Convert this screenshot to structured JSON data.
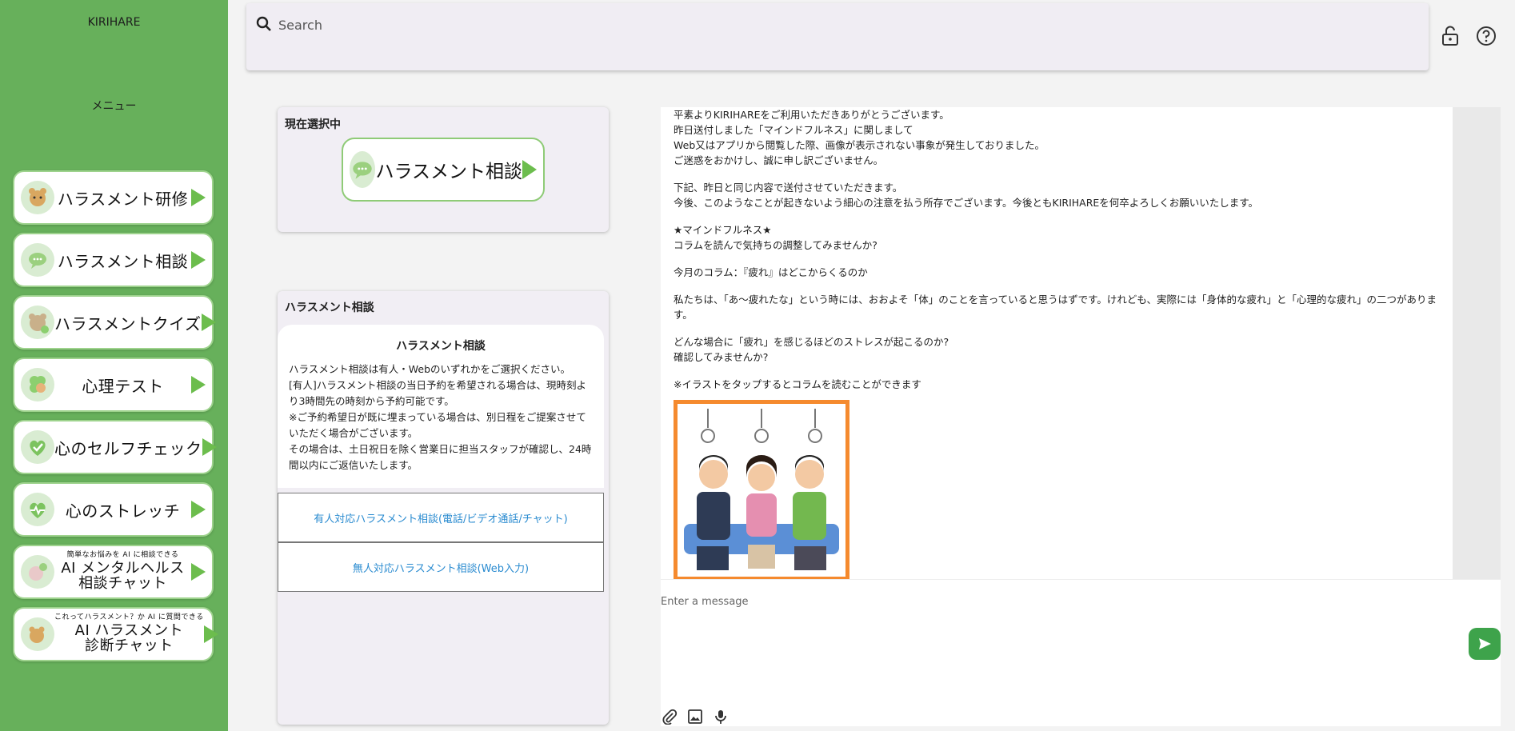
{
  "sidebar": {
    "brand": "KIRIHARE",
    "menu_title": "メニュー",
    "items": [
      {
        "label": "ハラスメント研修"
      },
      {
        "label": "ハラスメント相談"
      },
      {
        "label": "ハラスメントクイズ"
      },
      {
        "label": "心理テスト"
      },
      {
        "label": "心のセルフチェック"
      },
      {
        "label": "心のストレッチ"
      },
      {
        "sub": "簡単なお悩みを AI に相談できる",
        "line1": "AI メンタルヘルス",
        "line2": "相談チャット"
      },
      {
        "sub": "これってハラスメント？か AI に質問できる",
        "line1": "AI ハラスメント",
        "line2": "診断チャット"
      }
    ]
  },
  "search": {
    "placeholder": "Search"
  },
  "topbar": {
    "lock_icon": "lock-open-icon",
    "help_icon": "help-icon"
  },
  "selected": {
    "title": "現在選択中",
    "button_label": "ハラスメント相談"
  },
  "consult": {
    "panel_title": "ハラスメント相談",
    "card_title": "ハラスメント相談",
    "body": [
      "ハラスメント相談は有人・Webのいずれかをご選択ください。",
      "[有人]ハラスメント相談の当日予約を希望される場合は、現時刻より3時間先の時刻から予約可能です。",
      "※ご予約希望日が既に埋まっている場合は、別日程をご提案させていただく場合がございます。",
      "その場合は、土日祝日を除く営業日に担当スタッフが確認し、24時間以内にご返信いたします。"
    ],
    "option1": "有人対応ハラスメント相談(電話/ビデオ通話/チャット)",
    "option2": "無人対応ハラスメント相談(Web入力)"
  },
  "chat": {
    "paragraphs": [
      [
        "平素よりKIRIHAREをご利用いただきありがとうございます。",
        "昨日送付しました「マインドフルネス」に関しまして",
        "Web又はアプリから閲覧した際、画像が表示されない事象が発生しておりました。",
        "ご迷惑をおかけし、誠に申し訳ございません。"
      ],
      [
        "下記、昨日と同じ内容で送付させていただきます。",
        "今後、このようなことが起きないよう細心の注意を払う所存でございます。今後ともKIRIHAREを何卒よろしくお願いいたします。"
      ],
      [
        "★マインドフルネス★",
        "コラムを読んで気持ちの調整してみませんか?"
      ],
      [
        "今月のコラム：『疲れ』はどこからくるのか"
      ],
      [
        "私たちは、「あ〜疲れたな」という時には、おおよそ「体」のことを言っていると思うはずです。けれども、実際には「身体的な疲れ」と「心理的な疲れ」の二つがあります。"
      ],
      [
        "どんな場合に「疲れ」を感じるほどのストレスが起こるのか?",
        "確認してみませんか?"
      ],
      [
        "※イラストをタップするとコラムを読むことができます"
      ]
    ],
    "composer_placeholder": "Enter a message"
  }
}
